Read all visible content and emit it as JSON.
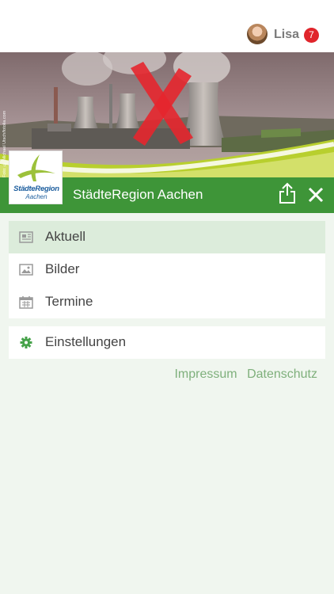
{
  "user": {
    "name": "Lisa",
    "notification_count": "7",
    "avatar_icon": "user-avatar"
  },
  "hero": {
    "photo_credit": "Foto: © Michael Utsch/fotolia.com",
    "overlay": "red-x-mark"
  },
  "header": {
    "title": "StädteRegion Aachen",
    "logo_text": "StädteRegion",
    "logo_subtext": "Aachen",
    "share_icon": "share-icon",
    "close_icon": "close-icon"
  },
  "menu": {
    "items": [
      {
        "label": "Aktuell",
        "icon": "newspaper-icon",
        "active": true
      },
      {
        "label": "Bilder",
        "icon": "image-icon",
        "active": false
      },
      {
        "label": "Termine",
        "icon": "calendar-icon",
        "active": false
      }
    ],
    "settings": {
      "label": "Einstellungen",
      "icon": "gear-icon"
    }
  },
  "footer": {
    "impressum": "Impressum",
    "datenschutz": "Datenschutz"
  },
  "colors": {
    "brand_green": "#3e9538",
    "active_bg": "#dcecdb",
    "link_green": "#7fb07c",
    "badge_red": "#e0252b",
    "background": "#f0f6ef"
  }
}
